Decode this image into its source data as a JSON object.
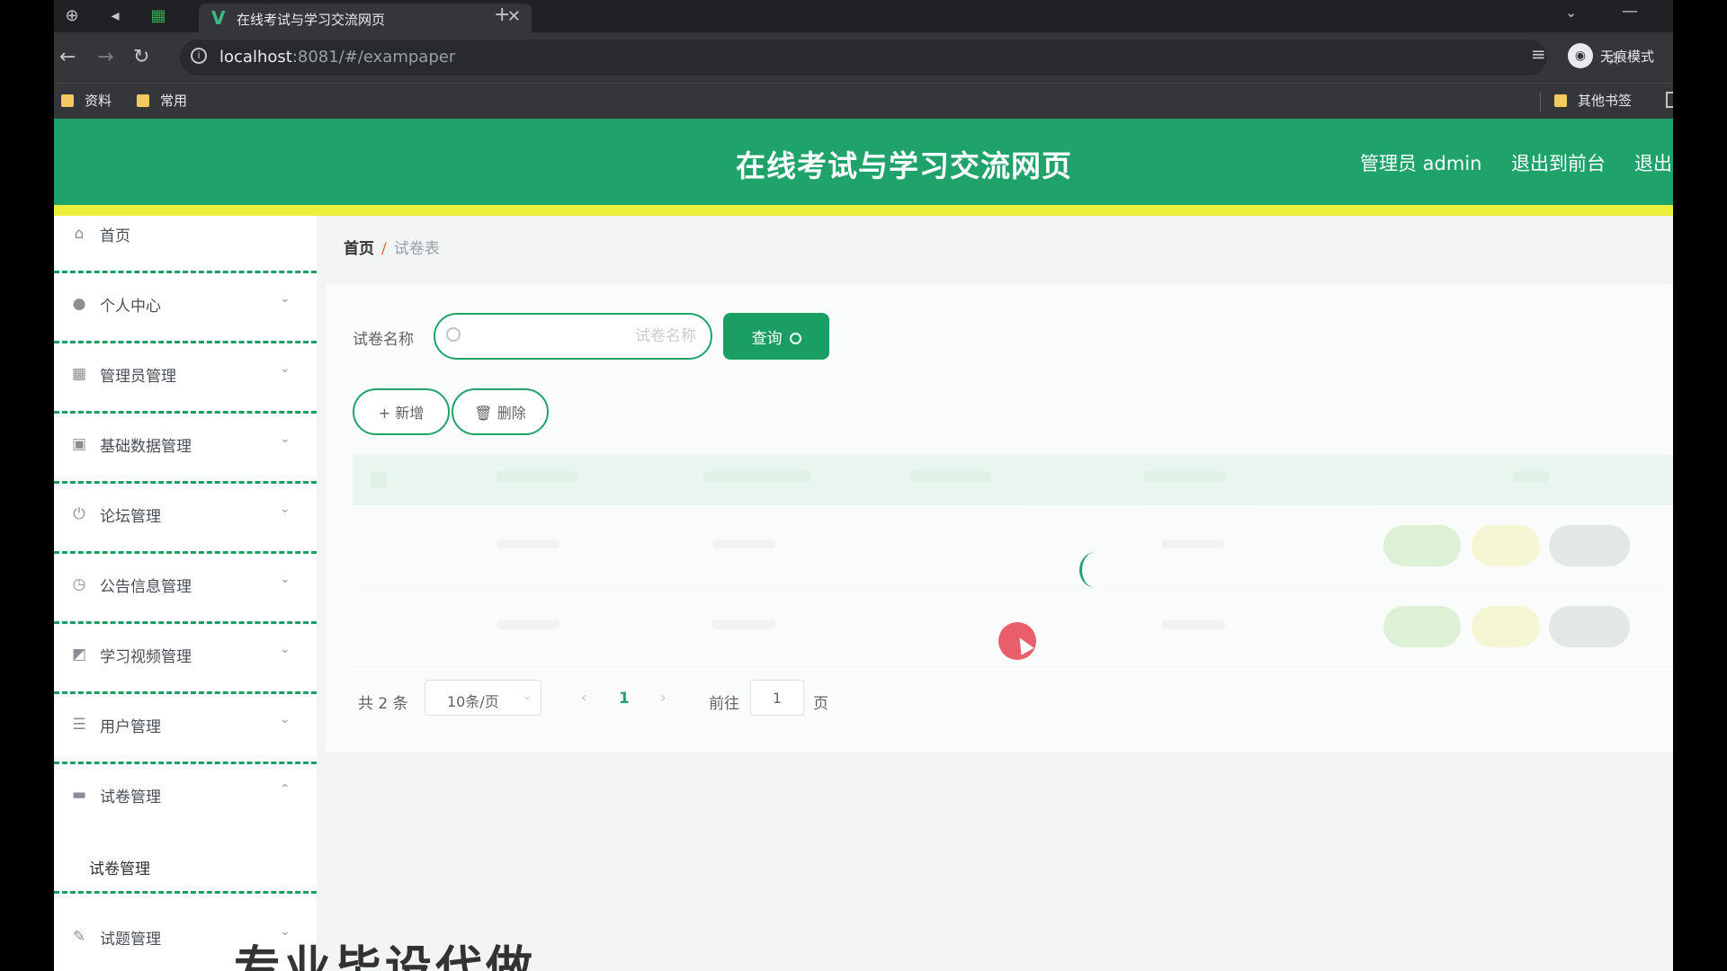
{
  "browser": {
    "tab_title": "在线考试与学习交流网页",
    "url_host": "localhost",
    "url_path": ":8081/#/exampaper",
    "incognito_label": "无痕模式",
    "bookmarks": [
      "资料",
      "常用"
    ],
    "other_bookmarks": "其他书签"
  },
  "header": {
    "title": "在线考试与学习交流网页",
    "user": "管理员 admin",
    "to_front": "退出到前台",
    "logout": "退出"
  },
  "colors": {
    "brand_green": "#1fa36a",
    "accent_yellow": "#eaf03b"
  },
  "sidebar": {
    "items": [
      {
        "label": "首页",
        "icon": "home-icon"
      },
      {
        "label": "个人中心",
        "icon": "user-icon"
      },
      {
        "label": "管理员管理",
        "icon": "grid-icon"
      },
      {
        "label": "基础数据管理",
        "icon": "clipboard-icon"
      },
      {
        "label": "论坛管理",
        "icon": "power-icon"
      },
      {
        "label": "公告信息管理",
        "icon": "clock-icon"
      },
      {
        "label": "学习视频管理",
        "icon": "chart-icon"
      },
      {
        "label": "用户管理",
        "icon": "list-icon"
      },
      {
        "label": "试卷管理",
        "icon": "chat-icon"
      },
      {
        "label": "试题管理",
        "icon": "edit-icon"
      }
    ],
    "sub_item": "试卷管理"
  },
  "breadcrumb": {
    "home": "首页",
    "current": "试卷表"
  },
  "search": {
    "label": "试卷名称",
    "placeholder": "试卷名称",
    "button": "查询"
  },
  "actions": {
    "add": "+ 新增",
    "delete": "删除"
  },
  "pagination": {
    "total": "共 2 条",
    "page_size": "10条/页",
    "current_page": "1",
    "goto_label": "前往",
    "goto_value": "1",
    "page_unit": "页"
  },
  "overlay": "专业毕设代做"
}
